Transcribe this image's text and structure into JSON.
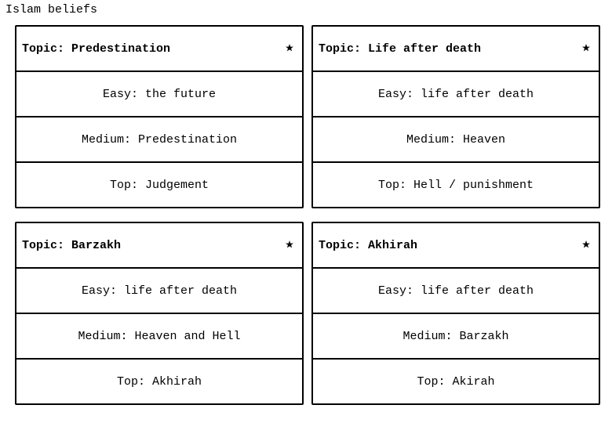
{
  "page": {
    "title": "Islam beliefs"
  },
  "cards": [
    {
      "topic": "Topic: Predestination",
      "icon": "star-and-crescent-icon",
      "easy": "Easy: the future",
      "medium": "Medium: Predestination",
      "top": "Top: Judgement"
    },
    {
      "topic": "Topic: Life after death",
      "icon": "star-and-crescent-icon",
      "easy": "Easy: life after death",
      "medium": "Medium: Heaven",
      "top": "Top: Hell / punishment"
    },
    {
      "topic": "Topic: Barzakh",
      "icon": "star-and-crescent-icon",
      "easy": "Easy: life after death",
      "medium": "Medium: Heaven and Hell",
      "top": "Top: Akhirah"
    },
    {
      "topic": "Topic: Akhirah",
      "icon": "star-and-crescent-icon",
      "easy": "Easy: life after death",
      "medium": "Medium: Barzakh",
      "top": "Top: Akirah"
    }
  ]
}
